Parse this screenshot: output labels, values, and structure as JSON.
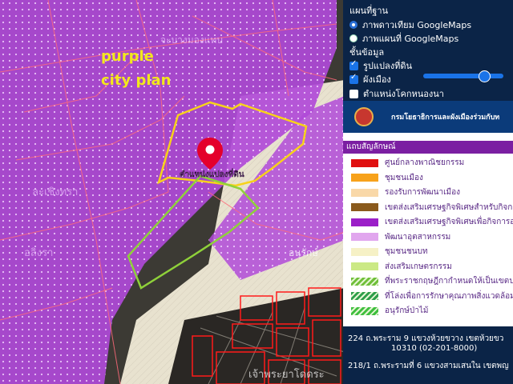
{
  "map": {
    "annotation_line1": "purple",
    "annotation_line2": "city plan",
    "marker_label": "ตำแหน่งแปลงที่ดิน",
    "place_label_top": "จะบางมองแทบ",
    "place_label_left1": "ละเชิงทรา",
    "place_label_left2": "อลิงรา",
    "place_label_right": "อนุรักษ์",
    "place_label_bottom": "เจ้าพระยาโดดระ",
    "colors": {
      "plan_purple": "#b04ad8",
      "outline_yellow": "#f7d21a",
      "outline_green": "#8fd13a",
      "marker_red": "#e4002b"
    }
  },
  "panel": {
    "basemap_heading": "แผนที่ฐาน",
    "basemap_options": [
      {
        "label": "ภาพดาวเทียม GoogleMaps",
        "selected": true
      },
      {
        "label": "ภาพแผนที่ GoogleMaps",
        "selected": false
      }
    ],
    "layers_heading": "ชั้นข้อมูล",
    "layers": [
      {
        "label": "รูปแปลงที่ดิน",
        "checked": true
      },
      {
        "label": "ผังเมือง",
        "checked": true
      },
      {
        "label": "ตำแหน่งโคกหนองนา",
        "checked": false
      }
    ],
    "opacity_value": 0.75
  },
  "legend": {
    "header": "กรมโยธาธิการและผังเมืองร่วมกับท",
    "subtitle": "แถบสัญลักษณ์",
    "items": [
      {
        "label": "ศูนย์กลางพาณิชยกรรม",
        "color": "#e01010"
      },
      {
        "label": "ชุมชนเมือง",
        "color": "#f7a21b"
      },
      {
        "label": "รองรับการพัฒนาเมือง",
        "color": "#f9d8a8"
      },
      {
        "label": "เขตส่งเสริมเศรษฐกิจพิเศษสำหรับกิจกา",
        "color": "#8a5a1c"
      },
      {
        "label": "เขตส่งเสริมเศรษฐกิจพิเศษเพื่อกิจการอุ",
        "color": "#9b1fc8"
      },
      {
        "label": "พัฒนาอุตสาหกรรม",
        "color": "#e1a6ee"
      },
      {
        "label": "ชุมชนชนบท",
        "color": "#f6f1c6"
      },
      {
        "label": "ส่งเสริมเกษตรกรรม",
        "color": "#cbe985"
      },
      {
        "label": "ที่พระราชกฤษฎีกากำหนดให้เป็นเขตปฏ",
        "color": "#6fbf3a"
      },
      {
        "label": "ที่โล่งเพื่อการรักษาคุณภาพสิ่งแวดล้อม",
        "color": "#2e9e4a"
      },
      {
        "label": "อนุรักษ์ป่าไม้",
        "color": "#3fbf3f"
      }
    ]
  },
  "address": {
    "line1": "224 ถ.พระราม 9 แขวงห้วยขวาง เขตห้วยขว",
    "line2": "10310 (02-201-8000)",
    "line3": "218/1 ถ.พระรามที่ 6 แขวงสามเสนใน เขตพญ"
  }
}
